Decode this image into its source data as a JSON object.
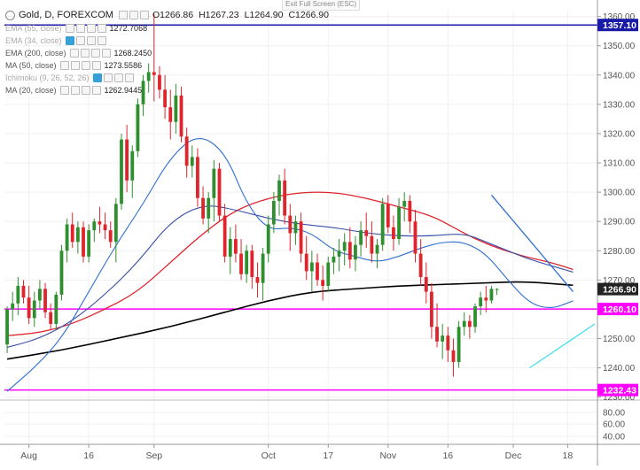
{
  "header": {
    "symbol": "Gold, D, FOREXCOM",
    "ohlc": {
      "open": "O1266.86",
      "high": "H1267.23",
      "low": "L1264.90",
      "close": "C1266.90"
    },
    "exit_fullscreen": "Exit Full Screen (ESC)"
  },
  "indicators": [
    {
      "name": "EMA (55, close)",
      "value": "1272.7068",
      "color": "#3a4fa8",
      "faded": true
    },
    {
      "name": "EMA (34, close)",
      "value": "",
      "color": "#2e6fd0",
      "faded": true
    },
    {
      "name": "EMA (200, close)",
      "value": "1268.2450",
      "color": "#000000",
      "faded": false
    },
    {
      "name": "MA (50, close)",
      "value": "1273.5586",
      "color": "#e0242c",
      "faded": false
    },
    {
      "name": "Ichimoku (9, 26, 52, 26)",
      "value": "",
      "color": "#7cc",
      "faded": true
    },
    {
      "name": "MA (20, close)",
      "value": "1262.9445",
      "color": "#2e6fd0",
      "faded": false
    }
  ],
  "chart_data": {
    "type": "candlestick",
    "price_axis": {
      "ticks": [
        "1360.00",
        "1350.00",
        "1340.00",
        "1330.00",
        "1320.00",
        "1310.00",
        "1300.00",
        "1290.00",
        "1280.00",
        "1270.00",
        "1250.00",
        "1240.00",
        "1230.00"
      ],
      "ylim": [
        1229,
        1362
      ]
    },
    "sub_axis": {
      "ticks": [
        "80.00",
        "60.00",
        "40.00"
      ]
    },
    "price_labels": [
      {
        "text": "1357.10",
        "value": 1357.1,
        "bg": "#1a1aa8"
      },
      {
        "text": "1266.90",
        "value": 1266.9,
        "bg": "#222222"
      },
      {
        "text": "1260.10",
        "value": 1260.1,
        "bg": "#ff00ff"
      },
      {
        "text": "1232.43",
        "value": 1232.43,
        "bg": "#ff00ff"
      }
    ],
    "hlines": [
      {
        "value": 1357.1,
        "color": "#1a1aa8"
      },
      {
        "value": 1260.1,
        "color": "#ff00ff"
      },
      {
        "value": 1232.43,
        "color": "#ff00ff"
      }
    ],
    "x_labels": [
      {
        "text": "Aug",
        "bar": 4
      },
      {
        "text": "16",
        "bar": 15
      },
      {
        "text": "Sep",
        "bar": 27
      },
      {
        "text": "Oct",
        "bar": 48
      },
      {
        "text": "17",
        "bar": 59
      },
      {
        "text": "Nov",
        "bar": 70
      },
      {
        "text": "16",
        "bar": 81
      },
      {
        "text": "Dec",
        "bar": 93
      },
      {
        "text": "18",
        "bar": 103
      }
    ],
    "candles": [
      [
        1248,
        1261,
        1245,
        1260
      ],
      [
        1260,
        1266,
        1256,
        1262
      ],
      [
        1262,
        1271,
        1258,
        1268
      ],
      [
        1268,
        1270,
        1262,
        1264
      ],
      [
        1264,
        1268,
        1255,
        1257
      ],
      [
        1257,
        1266,
        1254,
        1263
      ],
      [
        1263,
        1270,
        1260,
        1267
      ],
      [
        1267,
        1269,
        1257,
        1259
      ],
      [
        1259,
        1262,
        1253,
        1255
      ],
      [
        1255,
        1266,
        1253,
        1265
      ],
      [
        1265,
        1282,
        1263,
        1280
      ],
      [
        1280,
        1291,
        1276,
        1289
      ],
      [
        1289,
        1293,
        1281,
        1283
      ],
      [
        1283,
        1290,
        1279,
        1288
      ],
      [
        1288,
        1290,
        1276,
        1278
      ],
      [
        1278,
        1289,
        1276,
        1287
      ],
      [
        1287,
        1291,
        1283,
        1290
      ],
      [
        1290,
        1295,
        1286,
        1289
      ],
      [
        1289,
        1293,
        1284,
        1287
      ],
      [
        1287,
        1290,
        1281,
        1283
      ],
      [
        1283,
        1298,
        1276,
        1296
      ],
      [
        1296,
        1320,
        1294,
        1318
      ],
      [
        1318,
        1323,
        1300,
        1304
      ],
      [
        1304,
        1316,
        1298,
        1314
      ],
      [
        1314,
        1332,
        1312,
        1330
      ],
      [
        1330,
        1340,
        1326,
        1338
      ],
      [
        1338,
        1344,
        1334,
        1341
      ],
      [
        1341,
        1361,
        1331,
        1340
      ],
      [
        1340,
        1343,
        1332,
        1335
      ],
      [
        1335,
        1340,
        1325,
        1329
      ],
      [
        1329,
        1335,
        1318,
        1324
      ],
      [
        1324,
        1337,
        1320,
        1333
      ],
      [
        1333,
        1336,
        1317,
        1319
      ],
      [
        1319,
        1322,
        1305,
        1309
      ],
      [
        1309,
        1316,
        1305,
        1312
      ],
      [
        1312,
        1315,
        1295,
        1298
      ],
      [
        1298,
        1302,
        1289,
        1291
      ],
      [
        1291,
        1300,
        1286,
        1298
      ],
      [
        1298,
        1311,
        1290,
        1308
      ],
      [
        1308,
        1310,
        1290,
        1292
      ],
      [
        1292,
        1296,
        1276,
        1278
      ],
      [
        1278,
        1288,
        1272,
        1284
      ],
      [
        1284,
        1289,
        1276,
        1279
      ],
      [
        1279,
        1284,
        1270,
        1272
      ],
      [
        1272,
        1282,
        1269,
        1280
      ],
      [
        1280,
        1282,
        1267,
        1271
      ],
      [
        1271,
        1276,
        1264,
        1269
      ],
      [
        1269,
        1281,
        1263,
        1279
      ],
      [
        1279,
        1292,
        1276,
        1289
      ],
      [
        1289,
        1300,
        1286,
        1297
      ],
      [
        1297,
        1306,
        1292,
        1304
      ],
      [
        1304,
        1308,
        1289,
        1292
      ],
      [
        1292,
        1296,
        1280,
        1286
      ],
      [
        1286,
        1292,
        1282,
        1290
      ],
      [
        1290,
        1293,
        1276,
        1279
      ],
      [
        1279,
        1285,
        1270,
        1273
      ],
      [
        1273,
        1280,
        1266,
        1276
      ],
      [
        1276,
        1279,
        1268,
        1270
      ],
      [
        1270,
        1275,
        1263,
        1268
      ],
      [
        1268,
        1278,
        1266,
        1276
      ],
      [
        1276,
        1281,
        1272,
        1278
      ],
      [
        1278,
        1284,
        1273,
        1280
      ],
      [
        1280,
        1286,
        1275,
        1283
      ],
      [
        1283,
        1288,
        1274,
        1277
      ],
      [
        1277,
        1285,
        1273,
        1282
      ],
      [
        1282,
        1290,
        1278,
        1287
      ],
      [
        1287,
        1293,
        1281,
        1285
      ],
      [
        1285,
        1290,
        1276,
        1279
      ],
      [
        1279,
        1284,
        1274,
        1282
      ],
      [
        1282,
        1298,
        1280,
        1296
      ],
      [
        1296,
        1299,
        1286,
        1288
      ],
      [
        1288,
        1292,
        1280,
        1284
      ],
      [
        1284,
        1298,
        1282,
        1295
      ],
      [
        1295,
        1300,
        1290,
        1297
      ],
      [
        1297,
        1299,
        1286,
        1290
      ],
      [
        1290,
        1294,
        1276,
        1279
      ],
      [
        1279,
        1284,
        1268,
        1271
      ],
      [
        1271,
        1276,
        1262,
        1266
      ],
      [
        1266,
        1269,
        1250,
        1254
      ],
      [
        1254,
        1262,
        1247,
        1249
      ],
      [
        1249,
        1255,
        1243,
        1251
      ],
      [
        1251,
        1254,
        1242,
        1246
      ],
      [
        1246,
        1250,
        1237,
        1242
      ],
      [
        1242,
        1256,
        1240,
        1254
      ],
      [
        1254,
        1259,
        1251,
        1256
      ],
      [
        1256,
        1258,
        1250,
        1254
      ],
      [
        1254,
        1262,
        1252,
        1261
      ],
      [
        1261,
        1266,
        1258,
        1264
      ],
      [
        1264,
        1268,
        1259,
        1263
      ],
      [
        1263,
        1268,
        1262,
        1267
      ],
      [
        1266.86,
        1267.23,
        1264.9,
        1266.9
      ]
    ],
    "series": [
      {
        "name": "EMA (200, close)",
        "color": "#000000",
        "width": 1.6,
        "values": [
          [
            0,
            1243
          ],
          [
            10,
            1246
          ],
          [
            20,
            1250
          ],
          [
            30,
            1254
          ],
          [
            40,
            1259
          ],
          [
            48,
            1263
          ],
          [
            56,
            1266
          ],
          [
            64,
            1267
          ],
          [
            72,
            1268
          ],
          [
            80,
            1268.5
          ],
          [
            88,
            1269
          ],
          [
            95,
            1269.5
          ],
          [
            104,
            1268.2
          ]
        ]
      },
      {
        "name": "MA (50, close)",
        "color": "#e0242c",
        "width": 1.3,
        "values": [
          [
            0,
            1251
          ],
          [
            6,
            1252
          ],
          [
            12,
            1255
          ],
          [
            18,
            1260
          ],
          [
            24,
            1266
          ],
          [
            30,
            1276
          ],
          [
            36,
            1286
          ],
          [
            42,
            1294
          ],
          [
            48,
            1298
          ],
          [
            54,
            1300
          ],
          [
            60,
            1300
          ],
          [
            66,
            1298
          ],
          [
            72,
            1295
          ],
          [
            78,
            1292
          ],
          [
            82,
            1288
          ],
          [
            86,
            1284
          ],
          [
            90,
            1281
          ],
          [
            95,
            1278
          ],
          [
            100,
            1276
          ],
          [
            104,
            1273.6
          ]
        ]
      },
      {
        "name": "EMA (55, close)",
        "color": "#3a4fa8",
        "width": 1.1,
        "values": [
          [
            0,
            1247
          ],
          [
            6,
            1250
          ],
          [
            12,
            1256
          ],
          [
            18,
            1265
          ],
          [
            24,
            1276
          ],
          [
            30,
            1290
          ],
          [
            36,
            1296
          ],
          [
            42,
            1294
          ],
          [
            48,
            1291
          ],
          [
            54,
            1289
          ],
          [
            60,
            1288
          ],
          [
            66,
            1286
          ],
          [
            72,
            1285
          ],
          [
            78,
            1285
          ],
          [
            84,
            1286
          ],
          [
            88,
            1283
          ],
          [
            92,
            1280
          ],
          [
            96,
            1277
          ],
          [
            104,
            1272.7
          ]
        ]
      },
      {
        "name": "MA (20, close)",
        "color": "#2e6fd0",
        "width": 1.1,
        "values": [
          [
            0,
            1232
          ],
          [
            5,
            1240
          ],
          [
            10,
            1250
          ],
          [
            15,
            1266
          ],
          [
            20,
            1282
          ],
          [
            25,
            1296
          ],
          [
            30,
            1312
          ],
          [
            35,
            1320
          ],
          [
            40,
            1314
          ],
          [
            44,
            1296
          ],
          [
            48,
            1287
          ],
          [
            52,
            1288
          ],
          [
            56,
            1286
          ],
          [
            60,
            1280
          ],
          [
            64,
            1278
          ],
          [
            68,
            1276
          ],
          [
            72,
            1278
          ],
          [
            76,
            1281
          ],
          [
            80,
            1283
          ],
          [
            84,
            1283
          ],
          [
            88,
            1279
          ],
          [
            92,
            1270
          ],
          [
            96,
            1262
          ],
          [
            100,
            1260
          ],
          [
            104,
            1262.9
          ]
        ]
      }
    ],
    "trendlines": [
      {
        "from": [
          89,
          1299
        ],
        "to": [
          104,
          1266
        ],
        "color": "#2e6fd0"
      },
      {
        "from": [
          96,
          1240
        ],
        "to": [
          108,
          1255
        ],
        "color": "#40e0e8"
      }
    ],
    "colors": {
      "up": "#2f8f2f",
      "down": "#e0242c",
      "grid": "#f0f0f0",
      "axis": "#555555"
    }
  }
}
